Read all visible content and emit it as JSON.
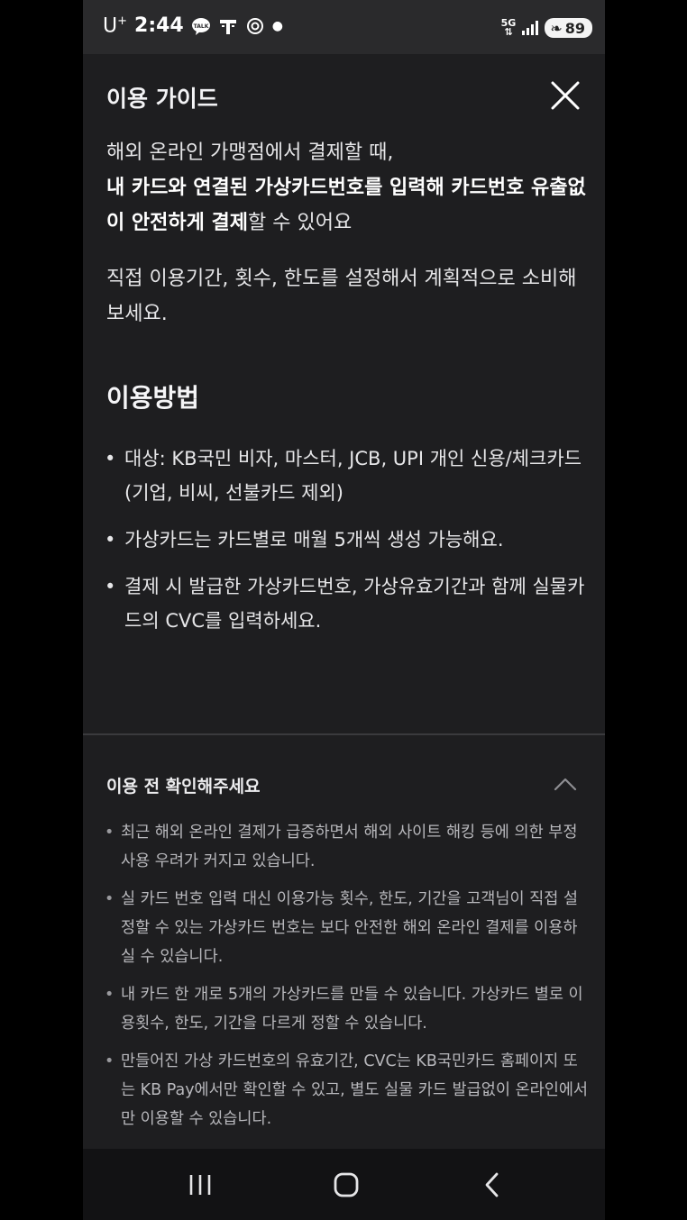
{
  "status_bar": {
    "carrier": "U",
    "carrier_sup": "+",
    "time": "2:44",
    "network": "5G",
    "battery": "89"
  },
  "header": {
    "title": "이용 가이드"
  },
  "intro": {
    "line1": "해외 온라인 가맹점에서 결제할 때,",
    "bold": "내 카드와 연결된 가상카드번호를 입력해 카드번호 유출없이 안전하게 결제",
    "tail": "할 수 있어요"
  },
  "para2": "직접 이용기간, 횟수, 한도를 설정해서 계획적으로 소비해보세요.",
  "usage": {
    "title": "이용방법",
    "items": [
      "대상: KB국민 비자, 마스터, JCB, UPI 개인 신용/체크카드",
      "(기업, 비씨, 선불카드 제외)",
      "가상카드는 카드별로 매월 5개씩 생성 가능해요.",
      "결제 시 발급한 가상카드번호, 가상유효기간과 함께 실물카드의 CVC를 입력하세요."
    ]
  },
  "notice": {
    "title": "이용 전 확인해주세요",
    "items": [
      "최근 해외 온라인 결제가 급증하면서 해외 사이트 해킹 등에 의한 부정 사용 우려가 커지고 있습니다.",
      "실 카드 번호 입력 대신 이용가능 횟수, 한도, 기간을 고객님이 직접 설정할 수 있는 가상카드 번호는 보다 안전한 해외 온라인 결제를 이용하실 수 있습니다.",
      "내 카드 한 개로 5개의 가상카드를 만들 수 있습니다. 가상카드 별로 이용횟수, 한도, 기간을 다르게 정할 수 있습니다.",
      "만들어진 가상 카드번호의 유효기간, CVC는 KB국민카드 홈페이지 또는 KB Pay에서만 확인할 수 있고, 별도 실물 카드 발급없이 온라인에서만 이용할 수 있습니다."
    ]
  },
  "icons": {
    "close": "close-icon",
    "chevron": "chevron-up-icon",
    "nav_recent": "recent-apps-icon",
    "nav_home": "home-icon",
    "nav_back": "back-icon"
  }
}
